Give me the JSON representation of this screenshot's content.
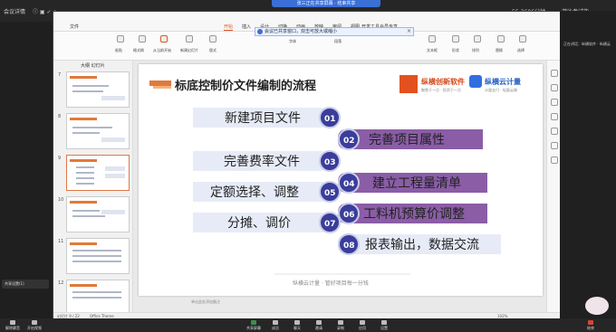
{
  "meeting": {
    "top_left": "会议详情",
    "share_banner": "张三正在共享屏幕 · 结束共享",
    "top_right_meeting_id": "55-3606分钟",
    "top_right_user": "游泳考试能",
    "sidebar_speaker": "正在讲话：纵横软件 · 纵横云",
    "left_bottom_label": "共享设置(1)",
    "bottom_left_label": "解除静音",
    "bottom_left_label2": "开启视频",
    "bottom_buttons": [
      "共享屏幕",
      "成员",
      "聊天",
      "邀请",
      "录制",
      "应用",
      "设置",
      "结束"
    ]
  },
  "wps": {
    "tabs": [
      "文件",
      "开始",
      "插入",
      "设计",
      "切换",
      "动画",
      "放映",
      "审阅",
      "视图",
      "开发工具",
      "会员专享"
    ],
    "active_tab_index": 1,
    "ribbon_labels": [
      "粘贴",
      "格式刷",
      "从当前开始",
      "新建幻灯片",
      "版式",
      "字体",
      "段落",
      "文本框",
      "形状",
      "排列",
      "替换",
      "选择"
    ],
    "notice": "会议已共享窗口，双击可放大或缩小",
    "thumbs_tab_label": "大纲  幻灯片",
    "thumb_numbers": [
      "7",
      "8",
      "9",
      "10",
      "11",
      "12"
    ],
    "active_thumb_index": 2,
    "status_slide": "幻灯片 9 / 22",
    "status_theme": "Office Theme",
    "status_notes": "单击此处添加备注",
    "status_zoom": "102%"
  },
  "slide": {
    "title": "标底控制价文件编制的流程",
    "logo1_text": "纵横创新软件",
    "logo1_sub": "聚焦于一点 · 投资于一点",
    "logo2_text": "纵横云计量",
    "logo2_sub": "计量支付 · 轻量云端",
    "steps": [
      {
        "num": "01",
        "label": "新建项目文件"
      },
      {
        "num": "02",
        "label": "完善项目属性"
      },
      {
        "num": "03",
        "label": "完善费率文件"
      },
      {
        "num": "04",
        "label": "建立工程量清单"
      },
      {
        "num": "05",
        "label": "定额选择、调整"
      },
      {
        "num": "06",
        "label": "工料机预算价调整"
      },
      {
        "num": "07",
        "label": "分摊、调价"
      },
      {
        "num": "08",
        "label": "报表输出，数据交流"
      }
    ],
    "footer": "纵横云计量 · 管好项目每一分钱"
  },
  "colors": {
    "accent": "#e07a3a",
    "circle": "#3a3d9a",
    "pill_left": "#e4e8f6",
    "pill_right": "#8e5fa8"
  }
}
